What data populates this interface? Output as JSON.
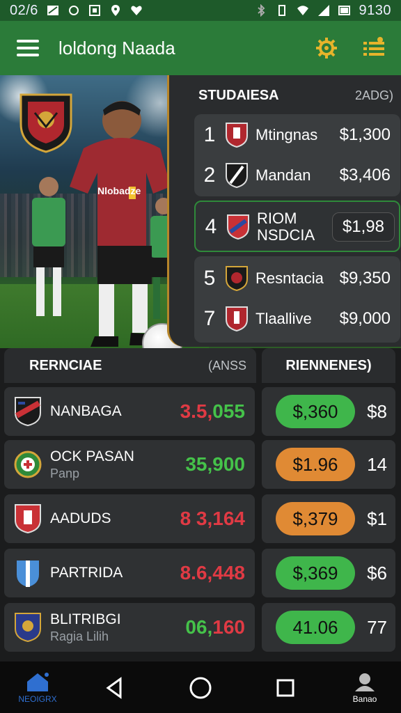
{
  "status_bar": {
    "time_left": "02/6",
    "time_right": "9130"
  },
  "app_bar": {
    "title": "loldong Naada"
  },
  "standings": {
    "title": "STUDAIESA",
    "subtitle": "2ADG)",
    "rows": [
      {
        "rank": "1",
        "name": "Mtingnas",
        "price": "$1,300"
      },
      {
        "rank": "2",
        "name": "Mandan",
        "price": "$3,406"
      },
      {
        "rank": "4",
        "name_line1": "RIOM",
        "name_line2": "NSDCIA",
        "price": "$1,98"
      },
      {
        "rank": "5",
        "name": "Resntacia",
        "price": "$9,350"
      },
      {
        "rank": "7",
        "name": "Tlaallive",
        "price": "$9,000"
      }
    ]
  },
  "section_left": {
    "title": "RERNCIAE",
    "subtitle": "(ANSS"
  },
  "section_right": {
    "title": "RIENNENES)"
  },
  "teams": [
    {
      "name": "NANBAGA",
      "sub": "",
      "value_part1": "3.5,",
      "value_part2": "055",
      "pill": "$,360",
      "pill_color": "#3fb64b",
      "right": "$8"
    },
    {
      "name": "OCK PASAN",
      "sub": "Panp",
      "value_part1": "35,900",
      "value_part2": "",
      "pill": "$1.96",
      "pill_color": "#e08a34",
      "right": "14"
    },
    {
      "name": "AADUDS",
      "sub": "",
      "value_part1": "8 3,164",
      "value_part2": "",
      "pill": "$,379",
      "pill_color": "#e08a34",
      "right": "$1"
    },
    {
      "name": "PARTRIDA",
      "sub": "",
      "value_part1": "8.6,448",
      "value_part2": "",
      "pill": "$,369",
      "pill_color": "#3fb64b",
      "right": "$6"
    },
    {
      "name": "BLITRIBGI",
      "sub": "Ragia Lilih",
      "value_part1": "06,",
      "value_part2": "160",
      "pill": "41.06",
      "pill_color": "#3fb64b",
      "right": "77"
    }
  ],
  "value_colors": {
    "red": "#e03a44",
    "green": "#45c24a"
  },
  "player": {
    "shirt_text": "Nlobadze"
  },
  "nav": {
    "home_label": "NEOIGRX",
    "profile_label": "Banao"
  }
}
